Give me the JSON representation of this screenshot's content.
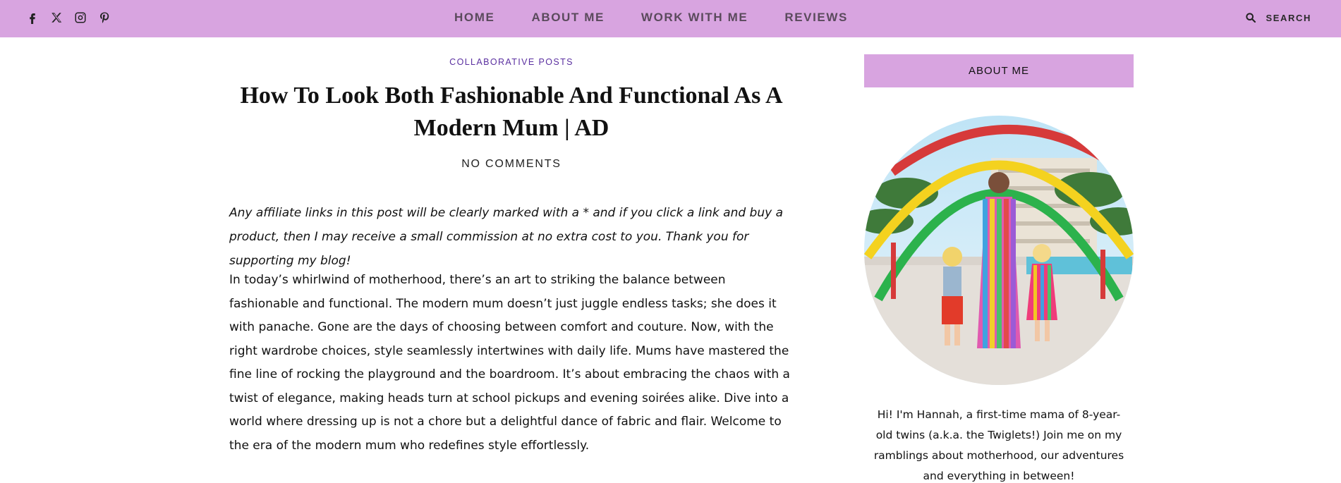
{
  "social": {
    "icons": [
      "facebook-icon",
      "x-icon",
      "instagram-icon",
      "pinterest-icon"
    ]
  },
  "nav": {
    "items": [
      "HOME",
      "ABOUT ME",
      "WORK WITH ME",
      "REVIEWS"
    ]
  },
  "search": {
    "label": "SEARCH",
    "icon": "search-icon"
  },
  "article": {
    "category": "COLLABORATIVE POSTS",
    "title": "How To Look Both Fashionable And Functional As A Modern Mum | AD",
    "comments": "NO COMMENTS",
    "disclaimer": "Any affiliate links in this post will be clearly marked with a * and if you click a link and buy a product, then I may receive a small commission at no extra cost to you. Thank you for supporting my blog!",
    "body": "In today’s whirlwind of motherhood, there’s an art to striking the balance between fashionable and functional. The modern mum doesn’t just juggle endless tasks; she does it with panache. Gone are the days of choosing between comfort and couture. Now, with the right wardrobe choices, style seamlessly intertwines with daily life. Mums have mastered the fine line of rocking the playground and the boardroom. It’s about embracing the chaos with a twist of elegance, making heads turn at school pickups and evening soirées alike. Dive into a world where dressing up is not a chore but a delightful dance of fabric and flair. Welcome to the era of the modern mum who redefines style effortlessly."
  },
  "sidebar": {
    "widget_title": "ABOUT ME",
    "bio": "Hi! I'm Hannah, a first-time mama of 8-year-old twins (a.k.a. the Twiglets!) Join me on my ramblings about motherhood, our adventures and everything in between!"
  },
  "colors": {
    "brand_pink": "#d8a4e0",
    "category_purple": "#5a2fa0",
    "nav_text": "#5a4a5c"
  }
}
